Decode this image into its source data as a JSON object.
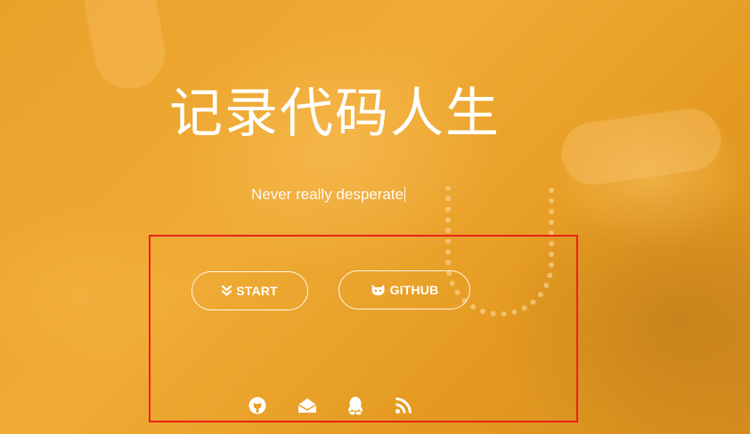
{
  "hero": {
    "title": "记录代码人生",
    "subtitle": "Never really desperate"
  },
  "buttons": {
    "start": {
      "label": "START",
      "icon": "double-chevron-down-icon"
    },
    "github": {
      "label": "GITHUB",
      "icon": "octocat-icon"
    }
  },
  "social": [
    {
      "name": "github",
      "icon": "github-icon"
    },
    {
      "name": "email",
      "icon": "envelope-icon"
    },
    {
      "name": "qq",
      "icon": "qq-penguin-icon"
    },
    {
      "name": "rss",
      "icon": "rss-icon"
    }
  ],
  "colors": {
    "overlay": "#e8a227",
    "text": "#ffffff",
    "highlight": "#e8231b"
  }
}
